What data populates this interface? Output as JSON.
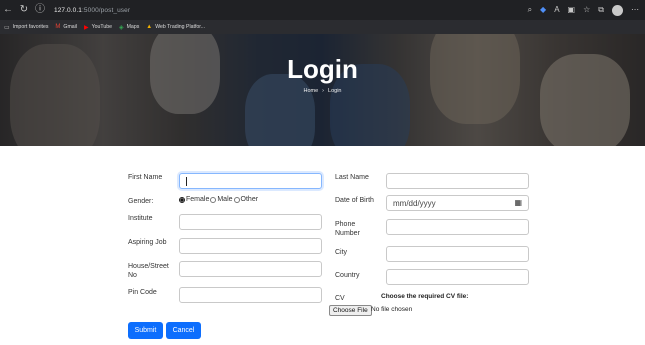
{
  "browser": {
    "url_host": "127.0.0.1",
    "url_path": ":5000/post_user",
    "bookmarks": [
      {
        "label": "Import favorites",
        "icon": "folder-icon"
      },
      {
        "label": "Gmail",
        "icon": "gmail-icon"
      },
      {
        "label": "YouTube",
        "icon": "youtube-icon"
      },
      {
        "label": "Maps",
        "icon": "maps-icon"
      },
      {
        "label": "Web Trading Platfor...",
        "icon": "trading-icon"
      }
    ]
  },
  "hero": {
    "title": "Login",
    "breadcrumb_home": "Home",
    "breadcrumb_sep": "›",
    "breadcrumb_current": "Login"
  },
  "form": {
    "first_name": {
      "label": "First Name",
      "value": ""
    },
    "last_name": {
      "label": "Last Name",
      "value": ""
    },
    "gender": {
      "label": "Gender:",
      "options": [
        "Female",
        "Male",
        "Other"
      ],
      "selected": "Female"
    },
    "date_of_birth": {
      "label": "Date of Birth",
      "placeholder": "mm/dd/yyyy"
    },
    "institute": {
      "label": "Institute",
      "value": ""
    },
    "phone_number": {
      "label_line1": "Phone",
      "label_line2": "Number",
      "value": ""
    },
    "aspiring_job": {
      "label": "Aspiring Job",
      "value": ""
    },
    "city": {
      "label": "City",
      "value": ""
    },
    "house_street": {
      "label_line1": "House/Street",
      "label_line2": "No",
      "value": ""
    },
    "country": {
      "label": "Country",
      "value": ""
    },
    "pin_code": {
      "label": "Pin Code",
      "value": ""
    },
    "cv": {
      "label": "CV",
      "hint": "Choose the required CV file:",
      "button": "Choose File",
      "status": "No file chosen"
    },
    "submit_label": "Submit",
    "cancel_label": "Cancel"
  },
  "colors": {
    "primary": "#0d6efd",
    "chrome_bg": "#202124"
  }
}
